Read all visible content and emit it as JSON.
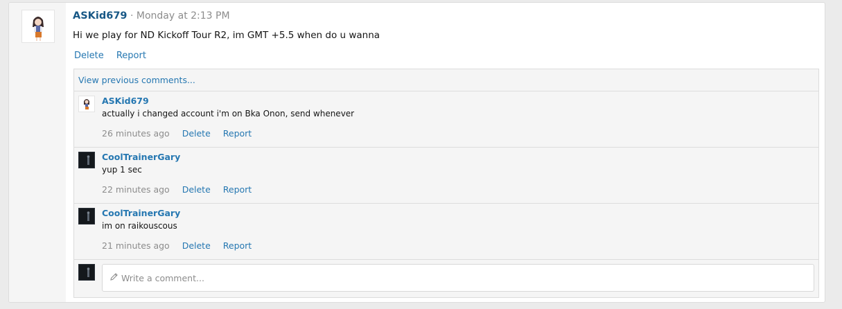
{
  "post": {
    "author": "ASKid679",
    "separator": "·",
    "date": "Monday at 2:13 PM",
    "message": "Hi we play for ND Kickoff Tour R2, im GMT +5.5 when do u wanna",
    "actions": {
      "delete": "Delete",
      "report": "Report"
    },
    "avatar_icon": "anime-girl-avatar"
  },
  "comments_section": {
    "view_previous": "View previous comments...",
    "items": [
      {
        "author": "ASKid679",
        "text": "actually i changed account i'm on Bka Onon, send whenever",
        "time": "26 minutes ago",
        "delete": "Delete",
        "report": "Report",
        "avatar_icon": "anime-girl-avatar"
      },
      {
        "author": "CoolTrainerGary",
        "text": "yup 1 sec",
        "time": "22 minutes ago",
        "delete": "Delete",
        "report": "Report",
        "avatar_icon": "dark-figure-avatar"
      },
      {
        "author": "CoolTrainerGary",
        "text": "im on raikouscous",
        "time": "21 minutes ago",
        "delete": "Delete",
        "report": "Report",
        "avatar_icon": "dark-figure-avatar"
      }
    ],
    "reply": {
      "placeholder": "Write a comment...",
      "icon": "pencil-icon",
      "avatar_icon": "dark-figure-avatar"
    }
  },
  "colors": {
    "link": "#2577b1",
    "author_main": "#185886",
    "muted": "#8c8c8c",
    "panel": "#f5f5f5",
    "border": "#dcdcdc"
  }
}
